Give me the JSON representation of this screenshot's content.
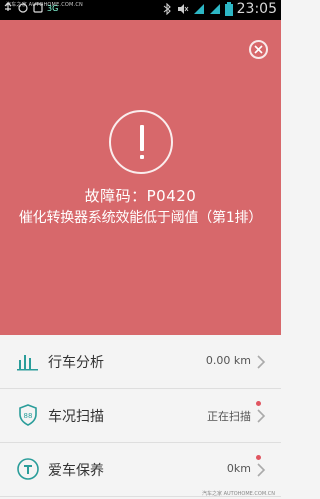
{
  "status_bar": {
    "watermark": "汽车之家 AUTOHOME.COM.CN",
    "network": "3G",
    "time": "23:05",
    "icons": [
      "usb-icon",
      "sync-icon",
      "notification-icon",
      "signal-icon",
      "bluetooth-icon",
      "mute-icon",
      "wifi-icon",
      "battery-icon"
    ]
  },
  "alert": {
    "fault_code_line": "故障码：P0420",
    "description": "催化转换器系统效能低于阈值（第1排）",
    "colors": {
      "background": "#d7686b",
      "text": "#ffffff"
    }
  },
  "list": {
    "items": [
      {
        "label": "行车分析",
        "value": "0.00 km",
        "icon": "bar-chart-icon",
        "badge": false
      },
      {
        "label": "车况扫描",
        "value": "正在扫描",
        "icon": "shield-88-icon",
        "badge": true
      },
      {
        "label": "爱车保养",
        "value": "0km",
        "icon": "wrench-icon",
        "badge": true
      }
    ],
    "accent": "#2a9d9a"
  },
  "footer_watermark": "汽车之家 AUTOHOME.COM.CN"
}
